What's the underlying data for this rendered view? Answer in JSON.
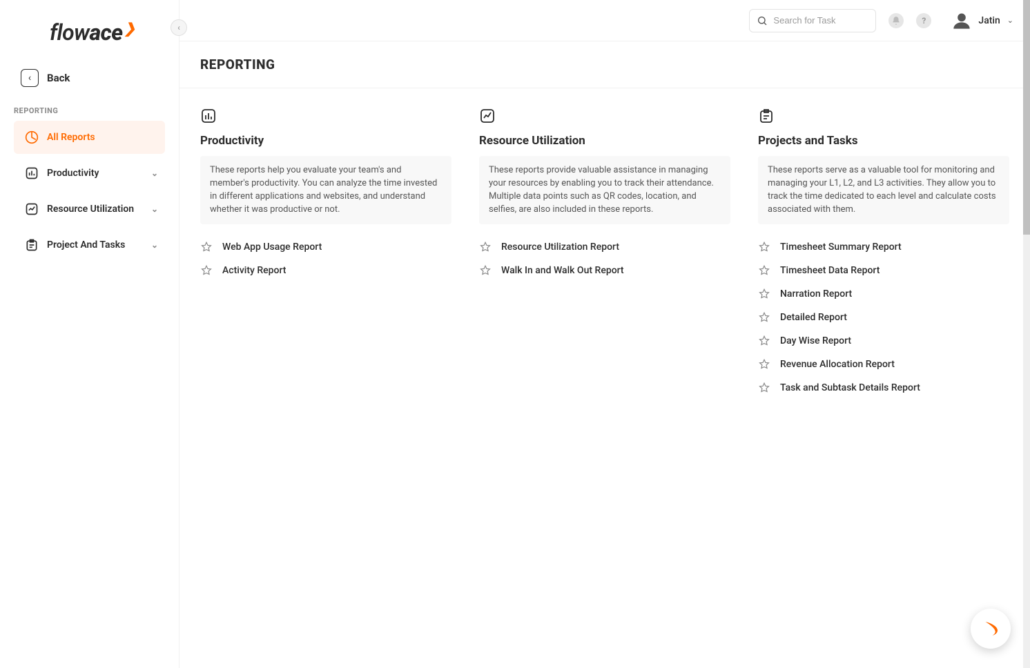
{
  "brand": {
    "part1": "flow",
    "part2": "ace"
  },
  "sidebar": {
    "back_label": "Back",
    "section_label": "REPORTING",
    "items": [
      {
        "label": "All Reports"
      },
      {
        "label": "Productivity"
      },
      {
        "label": "Resource Utilization"
      },
      {
        "label": "Project And Tasks"
      }
    ]
  },
  "header": {
    "search_placeholder": "Search for Task",
    "user_name": "Jatin"
  },
  "page": {
    "title": "REPORTING"
  },
  "categories": [
    {
      "title": "Productivity",
      "description": "These reports help you evaluate your team's and member's productivity. You can analyze the time invested in different applications and websites, and understand whether it was productive or not.",
      "reports": [
        "Web App Usage Report",
        "Activity Report"
      ]
    },
    {
      "title": "Resource Utilization",
      "description": "These reports provide valuable assistance in managing your resources by enabling you to track their attendance. Multiple data points such as QR codes, location, and selfies, are also included in these reports.",
      "reports": [
        "Resource Utilization Report",
        "Walk In and Walk Out Report"
      ]
    },
    {
      "title": "Projects and Tasks",
      "description": "These reports serve as a valuable tool for monitoring and managing your L1, L2, and L3 activities. They allow you to track the time dedicated to each level and calculate costs associated with them.",
      "reports": [
        "Timesheet Summary Report",
        "Timesheet Data Report",
        "Narration Report",
        "Detailed Report",
        "Day Wise Report",
        "Revenue Allocation Report",
        "Task and Subtask Details Report"
      ]
    }
  ]
}
